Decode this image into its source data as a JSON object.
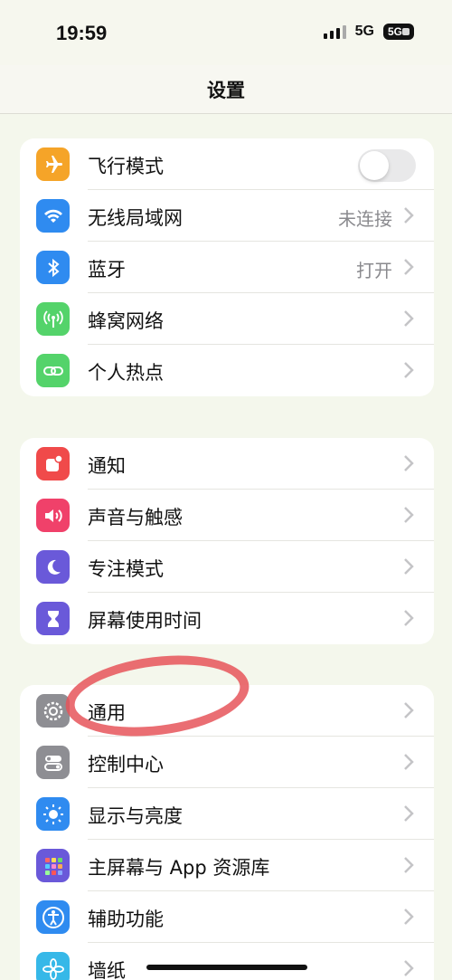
{
  "status_bar": {
    "time": "19:59",
    "network": "5G",
    "battery_label": "5G"
  },
  "header": {
    "title": "设置"
  },
  "groups": [
    {
      "items": [
        {
          "label": "飞行模式",
          "icon": "airplane-icon",
          "icon_bg": "#f5a428",
          "toggle": false
        },
        {
          "label": "无线局域网",
          "icon": "wifi-icon",
          "icon_bg": "#2f8bf0",
          "value": "未连接"
        },
        {
          "label": "蓝牙",
          "icon": "bluetooth-icon",
          "icon_bg": "#2f8bf0",
          "value": "打开"
        },
        {
          "label": "蜂窝网络",
          "icon": "cellular-icon",
          "icon_bg": "#54d36a"
        },
        {
          "label": "个人热点",
          "icon": "hotspot-icon",
          "icon_bg": "#54d36a"
        }
      ]
    },
    {
      "items": [
        {
          "label": "通知",
          "icon": "notification-icon",
          "icon_bg": "#f04a4a"
        },
        {
          "label": "声音与触感",
          "icon": "sound-icon",
          "icon_bg": "#f0416a"
        },
        {
          "label": "专注模式",
          "icon": "moon-icon",
          "icon_bg": "#6a59d9"
        },
        {
          "label": "屏幕使用时间",
          "icon": "hourglass-icon",
          "icon_bg": "#6a59d9"
        }
      ]
    },
    {
      "items": [
        {
          "label": "通用",
          "icon": "gear-icon",
          "icon_bg": "#8e8e93"
        },
        {
          "label": "控制中心",
          "icon": "toggles-icon",
          "icon_bg": "#8e8e93"
        },
        {
          "label": "显示与亮度",
          "icon": "sun-icon",
          "icon_bg": "#2f8bf0"
        },
        {
          "label": "主屏幕与 App 资源库",
          "icon": "grid-icon",
          "icon_bg": "#6a59d9"
        },
        {
          "label": "辅助功能",
          "icon": "accessibility-icon",
          "icon_bg": "#2f8bf0"
        },
        {
          "label": "墙纸",
          "icon": "flower-icon",
          "icon_bg": "#36b8e8"
        }
      ]
    }
  ]
}
